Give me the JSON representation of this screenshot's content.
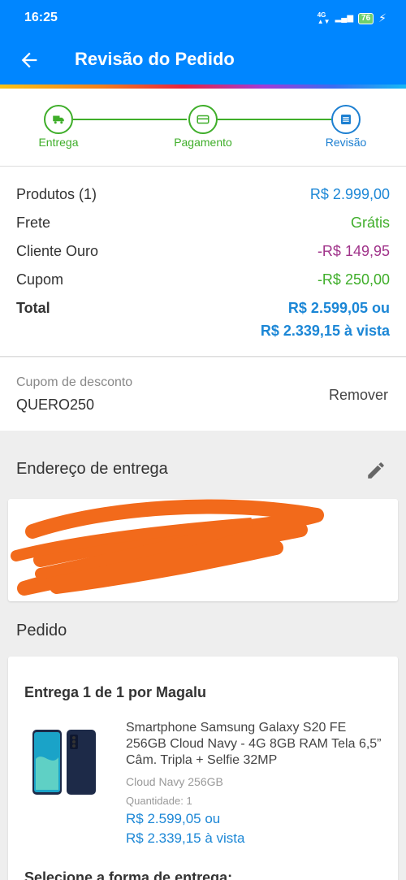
{
  "status_bar": {
    "time": "16:25",
    "network": "4G",
    "battery": "76"
  },
  "app_bar": {
    "title": "Revisão do Pedido"
  },
  "stepper": {
    "steps": [
      {
        "label": "Entrega",
        "state": "done",
        "icon": "truck-icon"
      },
      {
        "label": "Pagamento",
        "state": "done",
        "icon": "card-icon"
      },
      {
        "label": "Revisão",
        "state": "current",
        "icon": "list-icon"
      }
    ]
  },
  "summary": {
    "products_label": "Produtos (1)",
    "products_value": "R$ 2.999,00",
    "shipping_label": "Frete",
    "shipping_value": "Grátis",
    "gold_label": "Cliente Ouro",
    "gold_value": "-R$ 149,95",
    "coupon_label": "Cupom",
    "coupon_value": "-R$ 250,00",
    "total_label": "Total",
    "total_value": "R$ 2.599,05 ou",
    "total_cash": "R$ 2.339,15 à vista"
  },
  "coupon": {
    "label": "Cupom de desconto",
    "code": "QUERO250",
    "remove": "Remover"
  },
  "address": {
    "title": "Endereço de entrega"
  },
  "order": {
    "title": "Pedido",
    "delivery_title": "Entrega 1 de 1 por Magalu",
    "product_name": "Smartphone Samsung Galaxy S20 FE 256GB Cloud Navy - 4G 8GB RAM Tela 6,5” Câm. Tripla + Selfie 32MP",
    "variant": "Cloud Navy 256GB",
    "quantity": "Quantidade:  1",
    "price": "R$ 2.599,05 ou",
    "price_cash": "R$ 2.339,15 à vista",
    "shipping_select": "Selecione a forma de entrega:"
  },
  "colors": {
    "primary": "#0086ff",
    "green": "#3fae2a",
    "blue_text": "#1c87d6",
    "purple": "#a0338a",
    "redaction": "#f26a1b"
  }
}
